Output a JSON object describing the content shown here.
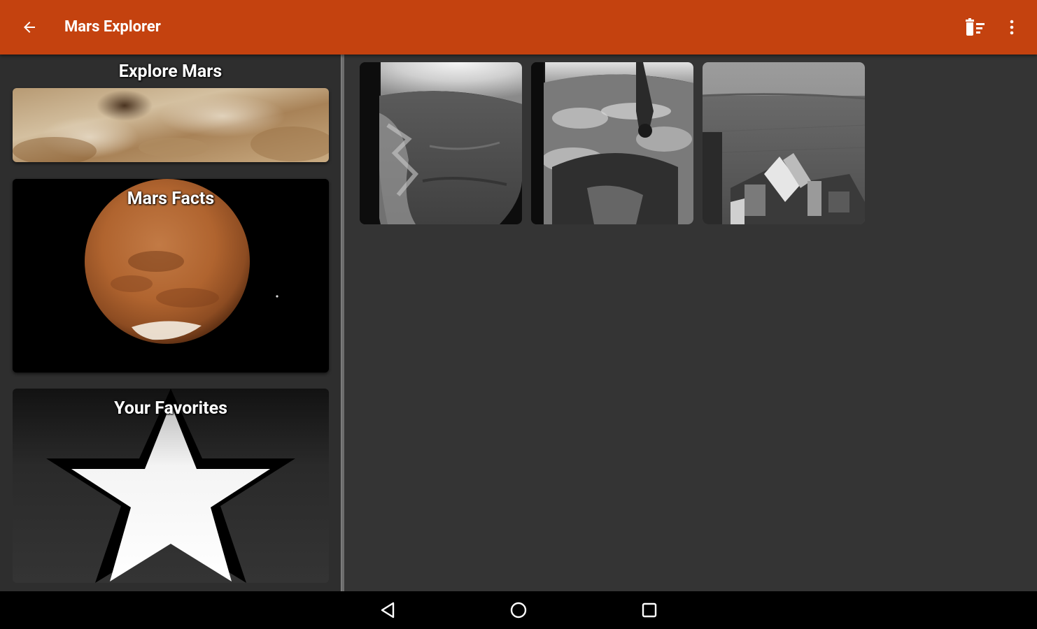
{
  "app_bar": {
    "title": "Mars Explorer",
    "color": "#c4420f",
    "back_icon": "arrow-back-icon",
    "delete_icon": "delete-sweep-icon",
    "overflow_icon": "more-vert-icon"
  },
  "sidebar": {
    "cards": [
      {
        "title": "Explore Mars",
        "image": "mars-surface-closeup"
      },
      {
        "title": "Mars Facts",
        "image": "planet-mars"
      },
      {
        "title": "Your Favorites",
        "image": "star-icon"
      }
    ]
  },
  "gallery": {
    "photos": [
      {
        "description": "rover-hazcam-sandy-terrain"
      },
      {
        "description": "rover-hazcam-rocky-terrain-with-arm"
      },
      {
        "description": "rover-deck-overlooking-landscape"
      }
    ]
  },
  "nav_bar": {
    "back_icon": "nav-back-icon",
    "home_icon": "nav-home-icon",
    "recents_icon": "nav-recents-icon"
  }
}
